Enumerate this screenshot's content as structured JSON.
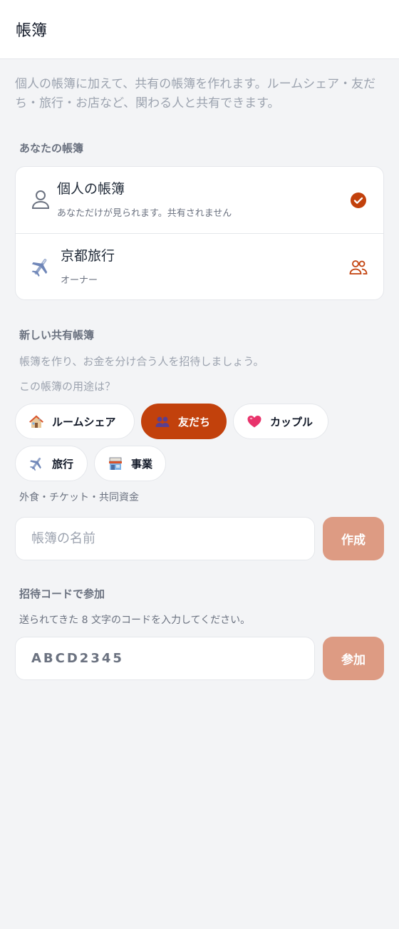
{
  "header": {
    "title": "帳簿"
  },
  "intro": "個人の帳簿に加えて、共有の帳簿を作れます。ルームシェア・友だち・旅行・お店など、関わる人と共有できます。",
  "your_ledgers": {
    "label": "あなたの帳簿",
    "items": [
      {
        "title": "個人の帳簿",
        "subtitle": "あなただけが見られます。共有されません",
        "icon": "person-icon",
        "status_icon": "check-circle-icon",
        "selected": true
      },
      {
        "title": "京都旅行",
        "subtitle": "オーナー",
        "icon": "airplane-icon",
        "status_icon": "group-icon",
        "selected": false
      }
    ]
  },
  "new_shared": {
    "label": "新しい共有帳簿",
    "description": "帳簿を作り、お金を分け合う人を招待しましょう。",
    "purpose_question": "この帳簿の用途は？",
    "purposes": [
      {
        "label": "ルームシェア",
        "icon": "house-icon",
        "active": false
      },
      {
        "label": "友だち",
        "icon": "people-icon",
        "active": true
      },
      {
        "label": "カップル",
        "icon": "heart-icon",
        "active": false
      },
      {
        "label": "旅行",
        "icon": "airplane-icon",
        "active": false
      },
      {
        "label": "事業",
        "icon": "shop-icon",
        "active": false
      }
    ],
    "purpose_hint": "外食・チケット・共同資金",
    "name_placeholder": "帳簿の名前",
    "create_label": "作成"
  },
  "join": {
    "label": "招待コードで参加",
    "description": "送られてきた 8 文字のコードを入力してください。",
    "code_placeholder": "ABCD2345",
    "join_label": "参加"
  },
  "colors": {
    "accent": "#c2410c",
    "button_disabled": "#dd9b83",
    "background": "#f3f4f6"
  }
}
